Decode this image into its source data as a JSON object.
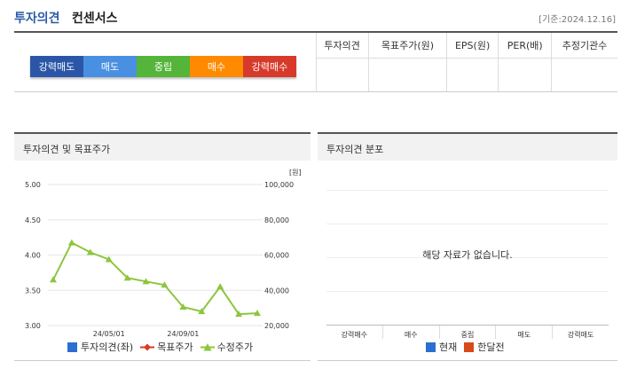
{
  "header": {
    "title_main": "투자의견",
    "title_sub": "컨센서스",
    "date": "[기준:2024.12.16]"
  },
  "opinion_scale": [
    {
      "label": "강력매도",
      "color": "#2b56a8"
    },
    {
      "label": "매도",
      "color": "#4a90e2"
    },
    {
      "label": "중립",
      "color": "#55b43a"
    },
    {
      "label": "매수",
      "color": "#ff8a00"
    },
    {
      "label": "강력매수",
      "color": "#d73a2a"
    }
  ],
  "stats_table": {
    "headers": [
      "투자의견",
      "목표주가(원)",
      "EPS(원)",
      "PER(배)",
      "추정기관수"
    ],
    "values": [
      "",
      "",
      "",
      "",
      ""
    ]
  },
  "left_panel": {
    "title": "투자의견 및 목표주가",
    "legend": [
      {
        "label": "투자의견(좌)",
        "color": "#2b6fd0",
        "symbol": "square"
      },
      {
        "label": "목표주가",
        "color": "#d73a2a",
        "symbol": "diamond-line"
      },
      {
        "label": "수정주가",
        "color": "#8cc63e",
        "symbol": "triangle-line"
      }
    ]
  },
  "right_panel": {
    "title": "투자의견 분포",
    "no_data": "해당 자료가 없습니다.",
    "categories": [
      "강력매수",
      "매수",
      "중립",
      "매도",
      "강력매도"
    ],
    "legend": [
      {
        "label": "현재",
        "color": "#2b6fd0"
      },
      {
        "label": "한달전",
        "color": "#d74a1a"
      }
    ]
  },
  "chart_data": {
    "type": "line",
    "title": "투자의견 및 목표주가",
    "y_left": {
      "ticks": [
        "5.00",
        "4.50",
        "4.00",
        "3.50",
        "3.00"
      ],
      "range": [
        3.0,
        5.0
      ]
    },
    "y_right": {
      "unit": "[원]",
      "ticks": [
        "100,000",
        "80,000",
        "60,000",
        "40,000",
        "20,000"
      ],
      "range": [
        20000,
        100000
      ]
    },
    "x_ticks": [
      {
        "label": "24/05/01",
        "index": 3
      },
      {
        "label": "24/09/01",
        "index": 7
      }
    ],
    "series": [
      {
        "name": "수정주가",
        "color": "#8cc63e",
        "axis": "right",
        "values": [
          46000,
          67000,
          61500,
          57500,
          47000,
          45000,
          43000,
          30500,
          28000,
          42000,
          26500,
          27000
        ]
      }
    ]
  }
}
